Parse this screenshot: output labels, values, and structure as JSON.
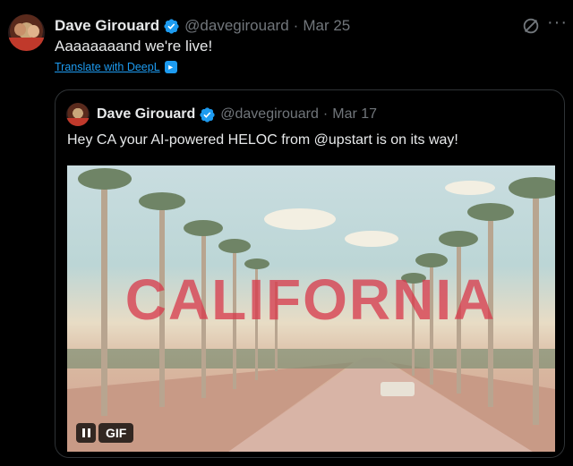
{
  "tweet": {
    "author_name": "Dave Girouard",
    "handle": "@davegirouard",
    "separator": "·",
    "date": "Mar 25",
    "text": "Aaaaaaaand we're live!",
    "translate_label": "Translate with DeepL",
    "more_label": "···"
  },
  "quote": {
    "author_name": "Dave Girouard",
    "handle": "@davegirouard",
    "separator": "·",
    "date": "Mar 17",
    "text": "Hey CA your AI-powered HELOC from @upstart is on its way!",
    "media": {
      "overlay_text": "CALIFORNIA",
      "badge": "GIF"
    }
  },
  "colors": {
    "background": "#000000",
    "text": "#e7e9ea",
    "muted": "#71767b",
    "link": "#1d9bf0",
    "verified": "#1d9bf0",
    "border": "#2f3336"
  }
}
